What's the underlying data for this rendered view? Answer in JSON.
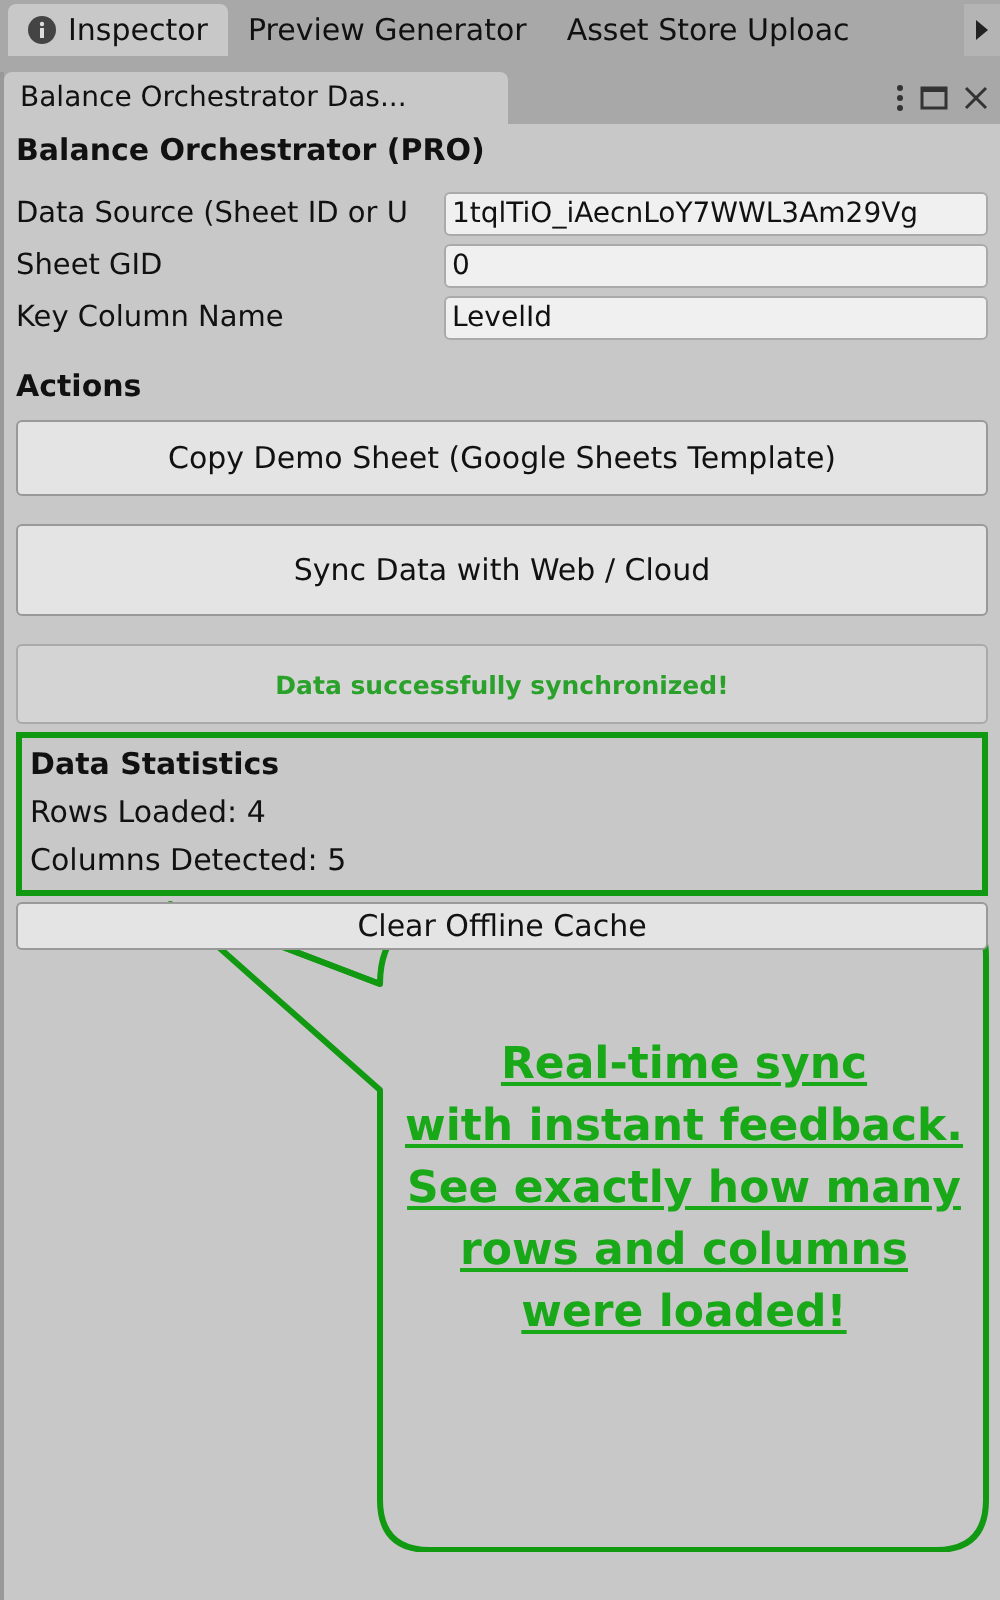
{
  "tabs": [
    {
      "label": "Inspector",
      "selected": true
    },
    {
      "label": "Preview Generator",
      "selected": false
    },
    {
      "label": "Asset Store Uploac",
      "selected": false
    }
  ],
  "window": {
    "title": "Balance Orchestrator Das..."
  },
  "heading": "Balance Orchestrator (PRO)",
  "fields": [
    {
      "label": "Data Source (Sheet ID or U",
      "value": "1tqlTiO_iAecnLoY7WWL3Am29Vg"
    },
    {
      "label": "Sheet GID",
      "value": "0"
    },
    {
      "label": "Key Column Name",
      "value": "LevelId"
    }
  ],
  "actions": {
    "title": "Actions",
    "buttons": [
      {
        "label": "Copy Demo Sheet (Google Sheets Template)",
        "kind": "normal"
      },
      {
        "label": "Sync Data with Web / Cloud",
        "kind": "tall"
      }
    ]
  },
  "status": "Data successfully synchronized!",
  "statistics": {
    "title": "Data Statistics",
    "lines": [
      "Rows Loaded: 4",
      "Columns Detected: 5"
    ]
  },
  "clear_button": "Clear Offline Cache",
  "callout": {
    "lines": [
      "Real-time sync",
      "with instant feedback.",
      "See exactly how many",
      "rows and columns",
      "were loaded!"
    ]
  }
}
